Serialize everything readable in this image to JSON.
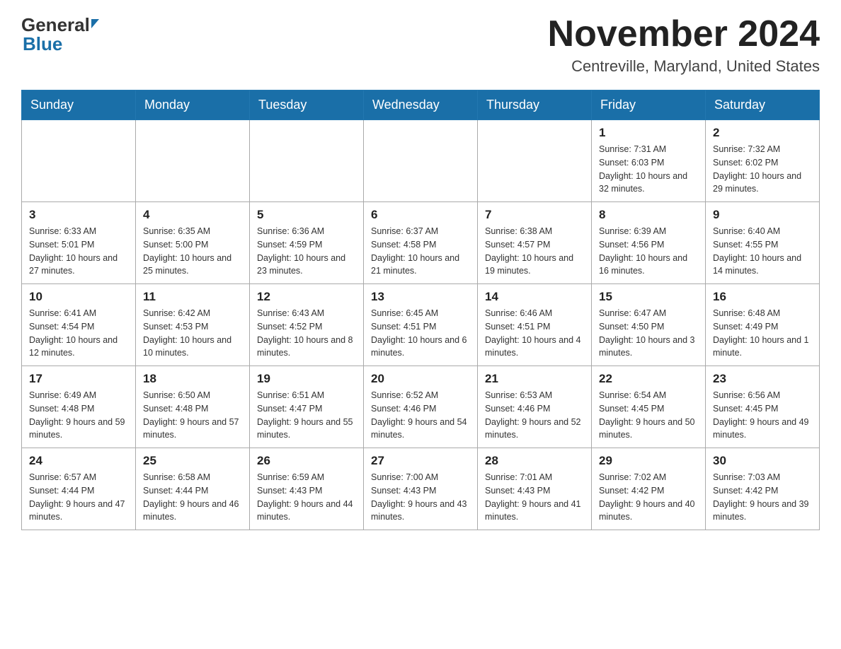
{
  "header": {
    "logo_general": "General",
    "logo_blue": "Blue",
    "month_title": "November 2024",
    "location": "Centreville, Maryland, United States"
  },
  "days_of_week": [
    "Sunday",
    "Monday",
    "Tuesday",
    "Wednesday",
    "Thursday",
    "Friday",
    "Saturday"
  ],
  "weeks": [
    {
      "days": [
        {
          "number": "",
          "info": ""
        },
        {
          "number": "",
          "info": ""
        },
        {
          "number": "",
          "info": ""
        },
        {
          "number": "",
          "info": ""
        },
        {
          "number": "",
          "info": ""
        },
        {
          "number": "1",
          "info": "Sunrise: 7:31 AM\nSunset: 6:03 PM\nDaylight: 10 hours and 32 minutes."
        },
        {
          "number": "2",
          "info": "Sunrise: 7:32 AM\nSunset: 6:02 PM\nDaylight: 10 hours and 29 minutes."
        }
      ]
    },
    {
      "days": [
        {
          "number": "3",
          "info": "Sunrise: 6:33 AM\nSunset: 5:01 PM\nDaylight: 10 hours and 27 minutes."
        },
        {
          "number": "4",
          "info": "Sunrise: 6:35 AM\nSunset: 5:00 PM\nDaylight: 10 hours and 25 minutes."
        },
        {
          "number": "5",
          "info": "Sunrise: 6:36 AM\nSunset: 4:59 PM\nDaylight: 10 hours and 23 minutes."
        },
        {
          "number": "6",
          "info": "Sunrise: 6:37 AM\nSunset: 4:58 PM\nDaylight: 10 hours and 21 minutes."
        },
        {
          "number": "7",
          "info": "Sunrise: 6:38 AM\nSunset: 4:57 PM\nDaylight: 10 hours and 19 minutes."
        },
        {
          "number": "8",
          "info": "Sunrise: 6:39 AM\nSunset: 4:56 PM\nDaylight: 10 hours and 16 minutes."
        },
        {
          "number": "9",
          "info": "Sunrise: 6:40 AM\nSunset: 4:55 PM\nDaylight: 10 hours and 14 minutes."
        }
      ]
    },
    {
      "days": [
        {
          "number": "10",
          "info": "Sunrise: 6:41 AM\nSunset: 4:54 PM\nDaylight: 10 hours and 12 minutes."
        },
        {
          "number": "11",
          "info": "Sunrise: 6:42 AM\nSunset: 4:53 PM\nDaylight: 10 hours and 10 minutes."
        },
        {
          "number": "12",
          "info": "Sunrise: 6:43 AM\nSunset: 4:52 PM\nDaylight: 10 hours and 8 minutes."
        },
        {
          "number": "13",
          "info": "Sunrise: 6:45 AM\nSunset: 4:51 PM\nDaylight: 10 hours and 6 minutes."
        },
        {
          "number": "14",
          "info": "Sunrise: 6:46 AM\nSunset: 4:51 PM\nDaylight: 10 hours and 4 minutes."
        },
        {
          "number": "15",
          "info": "Sunrise: 6:47 AM\nSunset: 4:50 PM\nDaylight: 10 hours and 3 minutes."
        },
        {
          "number": "16",
          "info": "Sunrise: 6:48 AM\nSunset: 4:49 PM\nDaylight: 10 hours and 1 minute."
        }
      ]
    },
    {
      "days": [
        {
          "number": "17",
          "info": "Sunrise: 6:49 AM\nSunset: 4:48 PM\nDaylight: 9 hours and 59 minutes."
        },
        {
          "number": "18",
          "info": "Sunrise: 6:50 AM\nSunset: 4:48 PM\nDaylight: 9 hours and 57 minutes."
        },
        {
          "number": "19",
          "info": "Sunrise: 6:51 AM\nSunset: 4:47 PM\nDaylight: 9 hours and 55 minutes."
        },
        {
          "number": "20",
          "info": "Sunrise: 6:52 AM\nSunset: 4:46 PM\nDaylight: 9 hours and 54 minutes."
        },
        {
          "number": "21",
          "info": "Sunrise: 6:53 AM\nSunset: 4:46 PM\nDaylight: 9 hours and 52 minutes."
        },
        {
          "number": "22",
          "info": "Sunrise: 6:54 AM\nSunset: 4:45 PM\nDaylight: 9 hours and 50 minutes."
        },
        {
          "number": "23",
          "info": "Sunrise: 6:56 AM\nSunset: 4:45 PM\nDaylight: 9 hours and 49 minutes."
        }
      ]
    },
    {
      "days": [
        {
          "number": "24",
          "info": "Sunrise: 6:57 AM\nSunset: 4:44 PM\nDaylight: 9 hours and 47 minutes."
        },
        {
          "number": "25",
          "info": "Sunrise: 6:58 AM\nSunset: 4:44 PM\nDaylight: 9 hours and 46 minutes."
        },
        {
          "number": "26",
          "info": "Sunrise: 6:59 AM\nSunset: 4:43 PM\nDaylight: 9 hours and 44 minutes."
        },
        {
          "number": "27",
          "info": "Sunrise: 7:00 AM\nSunset: 4:43 PM\nDaylight: 9 hours and 43 minutes."
        },
        {
          "number": "28",
          "info": "Sunrise: 7:01 AM\nSunset: 4:43 PM\nDaylight: 9 hours and 41 minutes."
        },
        {
          "number": "29",
          "info": "Sunrise: 7:02 AM\nSunset: 4:42 PM\nDaylight: 9 hours and 40 minutes."
        },
        {
          "number": "30",
          "info": "Sunrise: 7:03 AM\nSunset: 4:42 PM\nDaylight: 9 hours and 39 minutes."
        }
      ]
    }
  ]
}
